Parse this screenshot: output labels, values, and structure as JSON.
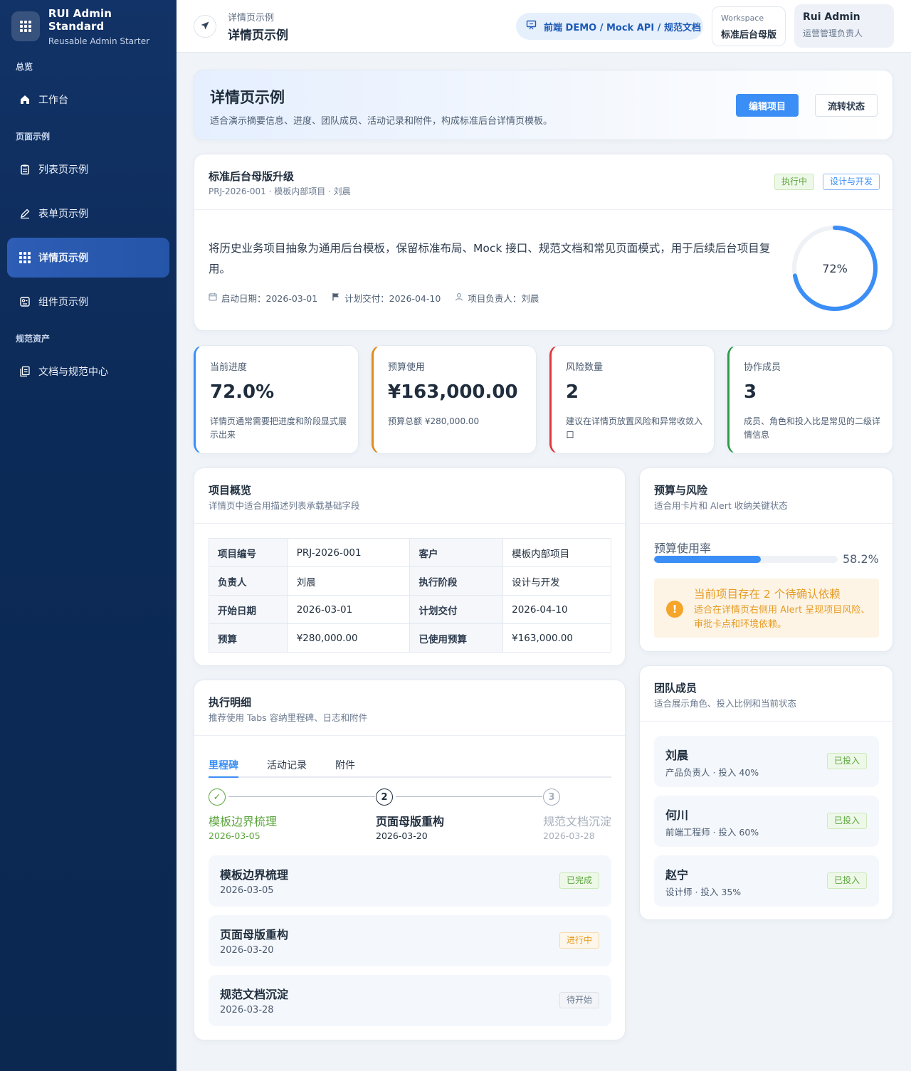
{
  "brand": {
    "title": "RUI Admin Standard",
    "subtitle": "Reusable Admin Starter"
  },
  "sidebar": {
    "groups": [
      {
        "label": "总览"
      },
      {
        "label": "页面示例"
      },
      {
        "label": "规范资产"
      }
    ],
    "items": [
      {
        "label": "工作台",
        "icon": "home-icon"
      },
      {
        "label": "列表页示例",
        "icon": "clipboard-icon"
      },
      {
        "label": "表单页示例",
        "icon": "pen-icon"
      },
      {
        "label": "详情页示例",
        "icon": "grid-icon",
        "active": true
      },
      {
        "label": "组件页示例",
        "icon": "component-icon"
      },
      {
        "label": "文档与规范中心",
        "icon": "docs-icon"
      }
    ]
  },
  "header": {
    "crumb_small": "详情页示例",
    "crumb_title": "详情页示例",
    "demo_pill": "前端 DEMO / Mock API / 规范文档",
    "workspace_label": "Workspace",
    "workspace_name": "标准后台母版",
    "user_name": "Rui Admin",
    "user_role": "运营管理负责人"
  },
  "hero": {
    "title": "详情页示例",
    "desc": "适合演示摘要信息、进度、团队成员、活动记录和附件，构成标准后台详情页模板。",
    "primary_btn": "编辑项目",
    "default_btn": "流转状态"
  },
  "project": {
    "title": "标准后台母版升级",
    "meta": "PRJ-2026-001 · 模板内部项目 · 刘晨",
    "status_tag": "执行中",
    "stage_tag": "设计与开发",
    "desc": "将历史业务项目抽象为通用后台模板，保留标准布局、Mock 接口、规范文档和常见页面模式，用于后续后台项目复用。",
    "start": "启动日期：2026-03-01",
    "delivery": "计划交付：2026-04-10",
    "owner": "项目负责人：刘晨",
    "progress": 72,
    "progress_label": "72%"
  },
  "stats": [
    {
      "label": "当前进度",
      "value": "72.0%",
      "note": "详情页通常需要把进度和阶段显式展示出来",
      "color": "#3a8ef6"
    },
    {
      "label": "预算使用",
      "value": "¥163,000.00",
      "note": "预算总额 ¥280,000.00",
      "color": "#e08a1e"
    },
    {
      "label": "风险数量",
      "value": "2",
      "note": "建议在详情页放置风险和异常收敛入口",
      "color": "#e0383a"
    },
    {
      "label": "协作成员",
      "value": "3",
      "note": "成员、角色和投入比是常见的二级详情信息",
      "color": "#2f9a4a"
    }
  ],
  "overview": {
    "title": "项目概览",
    "subtitle": "详情页中适合用描述列表承载基础字段",
    "rows": [
      [
        "项目编号",
        "PRJ-2026-001",
        "客户",
        "模板内部项目"
      ],
      [
        "负责人",
        "刘晨",
        "执行阶段",
        "设计与开发"
      ],
      [
        "开始日期",
        "2026-03-01",
        "计划交付",
        "2026-04-10"
      ],
      [
        "预算",
        "¥280,000.00",
        "已使用预算",
        "¥163,000.00"
      ]
    ]
  },
  "budget": {
    "title": "预算与风险",
    "subtitle": "适合用卡片和 Alert 收纳关键状态",
    "rate_label": "预算使用率",
    "rate": 58.2,
    "rate_text": "58.2%",
    "alert_title": "当前项目存在 2 个待确认依赖",
    "alert_desc": "适合在详情页右侧用 Alert 呈现项目风险、审批卡点和环境依赖。"
  },
  "team": {
    "title": "团队成员",
    "subtitle": "适合展示角色、投入比例和当前状态",
    "members": [
      {
        "name": "刘晨",
        "role": "产品负责人 · 投入 40%",
        "tag": "已投入"
      },
      {
        "name": "何川",
        "role": "前端工程师 · 投入 60%",
        "tag": "已投入"
      },
      {
        "name": "赵宁",
        "role": "设计师 · 投入 35%",
        "tag": "已投入"
      }
    ]
  },
  "execution": {
    "title": "执行明细",
    "subtitle": "推荐使用 Tabs 容纳里程碑、日志和附件",
    "tabs": [
      "里程碑",
      "活动记录",
      "附件"
    ],
    "steps": [
      {
        "num": "✓",
        "title": "模板边界梳理",
        "date": "2026-03-05",
        "state": "done"
      },
      {
        "num": "2",
        "title": "页面母版重构",
        "date": "2026-03-20",
        "state": "current"
      },
      {
        "num": "3",
        "title": "规范文档沉淀",
        "date": "2026-03-28",
        "state": "wait"
      }
    ],
    "milestones": [
      {
        "title": "模板边界梳理",
        "date": "2026-03-05",
        "tag": "已完成",
        "state": "done"
      },
      {
        "title": "页面母版重构",
        "date": "2026-03-20",
        "tag": "进行中",
        "state": "doing"
      },
      {
        "title": "规范文档沉淀",
        "date": "2026-03-28",
        "tag": "待开始",
        "state": "wait"
      }
    ]
  }
}
